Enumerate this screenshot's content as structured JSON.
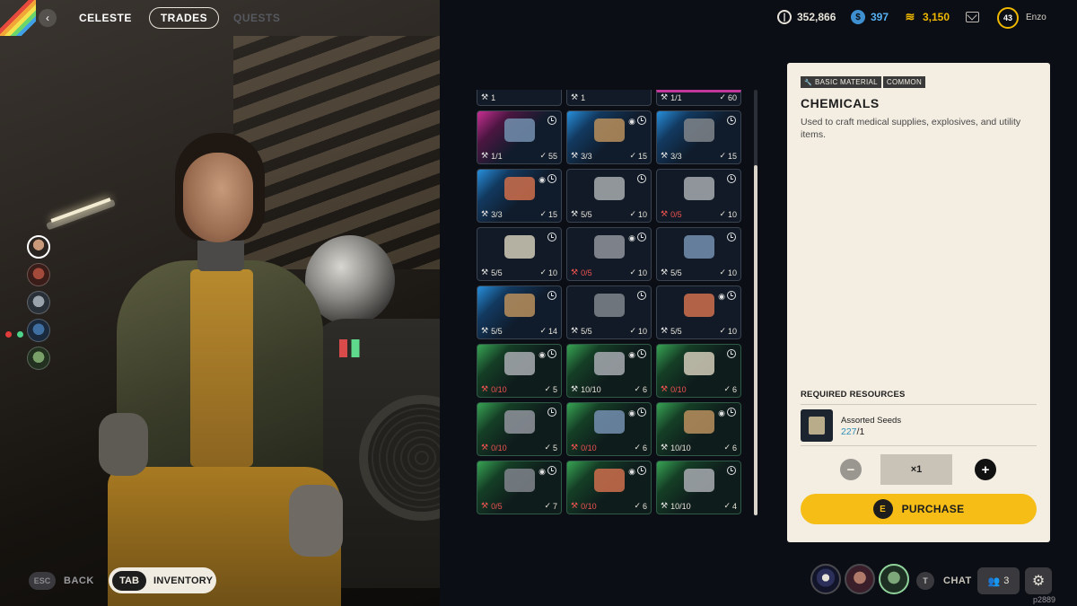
{
  "header": {
    "trader_name": "CELESTE",
    "tabs": [
      {
        "label": "TRADES",
        "active": true
      },
      {
        "label": "QUESTS",
        "active": false
      }
    ],
    "currencies": {
      "coins": "352,866",
      "blue": "397",
      "gold": "3,150"
    },
    "player": {
      "level": "43",
      "name": "Enzo"
    }
  },
  "grid": {
    "cells": [
      {
        "rarity": "plain",
        "cut": true,
        "stock": "1",
        "price": "",
        "stock_empty": false,
        "eye": false
      },
      {
        "rarity": "plain",
        "cut": true,
        "stock": "1",
        "price": "",
        "stock_empty": false,
        "eye": false
      },
      {
        "rarity": "pink",
        "cut": true,
        "stock": "1/1",
        "price": "60",
        "stock_empty": false,
        "eye": false
      },
      {
        "rarity": "pink",
        "stock": "1/1",
        "price": "55",
        "stock_empty": false,
        "eye": false
      },
      {
        "rarity": "blue",
        "stock": "3/3",
        "price": "15",
        "stock_empty": false,
        "eye": true
      },
      {
        "rarity": "blue",
        "stock": "3/3",
        "price": "15",
        "stock_empty": false,
        "eye": false
      },
      {
        "rarity": "blue",
        "stock": "3/3",
        "price": "15",
        "stock_empty": false,
        "eye": true
      },
      {
        "rarity": "plain",
        "stock": "5/5",
        "price": "10",
        "stock_empty": false,
        "eye": false
      },
      {
        "rarity": "plain",
        "stock": "0/5",
        "price": "10",
        "stock_empty": true,
        "eye": false
      },
      {
        "rarity": "plain",
        "stock": "5/5",
        "price": "10",
        "stock_empty": false,
        "eye": false
      },
      {
        "rarity": "plain",
        "stock": "0/5",
        "price": "10",
        "stock_empty": true,
        "eye": true
      },
      {
        "rarity": "plain",
        "stock": "5/5",
        "price": "10",
        "stock_empty": false,
        "eye": false
      },
      {
        "rarity": "blue",
        "stock": "5/5",
        "price": "14",
        "stock_empty": false,
        "eye": false
      },
      {
        "rarity": "plain",
        "stock": "5/5",
        "price": "10",
        "stock_empty": false,
        "eye": false
      },
      {
        "rarity": "plain",
        "stock": "5/5",
        "price": "10",
        "stock_empty": false,
        "eye": true
      },
      {
        "rarity": "green",
        "stock": "0/10",
        "price": "5",
        "stock_empty": true,
        "eye": true
      },
      {
        "rarity": "green",
        "stock": "10/10",
        "price": "6",
        "stock_empty": false,
        "eye": true
      },
      {
        "rarity": "green",
        "stock": "0/10",
        "price": "6",
        "stock_empty": true,
        "eye": false
      },
      {
        "rarity": "green",
        "stock": "0/10",
        "price": "5",
        "stock_empty": true,
        "eye": false
      },
      {
        "rarity": "green",
        "stock": "0/10",
        "price": "6",
        "stock_empty": true,
        "eye": true
      },
      {
        "rarity": "green",
        "stock": "10/10",
        "price": "6",
        "stock_empty": false,
        "eye": true
      },
      {
        "rarity": "green",
        "stock": "0/5",
        "price": "7",
        "stock_empty": true,
        "eye": true
      },
      {
        "rarity": "green",
        "stock": "0/10",
        "price": "6",
        "stock_empty": true,
        "eye": true
      },
      {
        "rarity": "green",
        "stock": "10/10",
        "price": "4",
        "stock_empty": false,
        "eye": false
      }
    ]
  },
  "detail": {
    "tags": [
      "BASIC MATERIAL",
      "COMMON"
    ],
    "title": "CHEMICALS",
    "description": "Used to craft medical supplies, explosives, and utility items.",
    "required_label": "REQUIRED RESOURCES",
    "resource_name": "Assorted Seeds",
    "resource_have": "227",
    "resource_need": "/1",
    "quantity": "×1",
    "minus": "−",
    "plus": "+",
    "purchase_key": "E",
    "purchase_label": "PURCHASE"
  },
  "footer": {
    "esc_key": "ESC",
    "back_label": "BACK",
    "tab_key": "TAB",
    "inventory_label": "INVENTORY",
    "chat_key": "T",
    "chat_label": "CHAT",
    "party_count": "3",
    "build_id": "p2889"
  },
  "icons": {
    "back": "‹",
    "wrench": "🔧",
    "eye": "◉",
    "check": "✓",
    "gear": "⚙",
    "party": "👥"
  },
  "colors": {
    "accent_yellow": "#f5bd15",
    "empty_red": "#ef5350",
    "blue_currency": "#56b0f2",
    "gold_currency": "#f0b800"
  }
}
